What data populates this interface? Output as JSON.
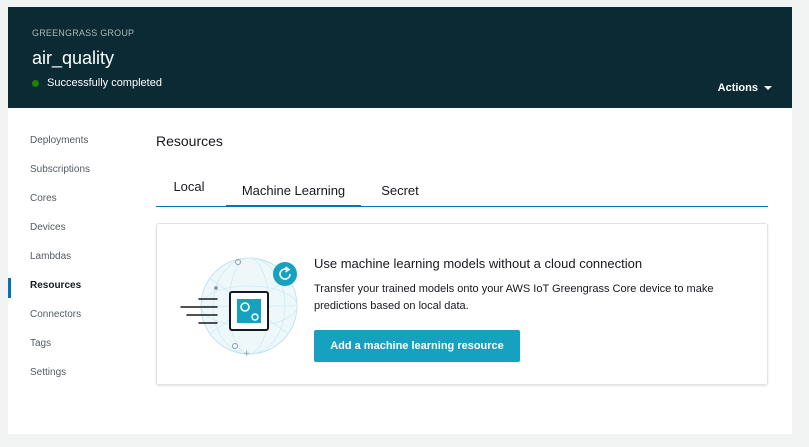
{
  "header": {
    "group_label": "GREENGRASS GROUP",
    "group_name": "air_quality",
    "status_text": "Successfully completed",
    "actions_label": "Actions"
  },
  "sidebar": {
    "items": [
      {
        "label": "Deployments",
        "active": false
      },
      {
        "label": "Subscriptions",
        "active": false
      },
      {
        "label": "Cores",
        "active": false
      },
      {
        "label": "Devices",
        "active": false
      },
      {
        "label": "Lambdas",
        "active": false
      },
      {
        "label": "Resources",
        "active": true
      },
      {
        "label": "Connectors",
        "active": false
      },
      {
        "label": "Tags",
        "active": false
      },
      {
        "label": "Settings",
        "active": false
      }
    ]
  },
  "main": {
    "section_title": "Resources",
    "tabs": [
      {
        "label": "Local",
        "active": false
      },
      {
        "label": "Machine Learning",
        "active": true
      },
      {
        "label": "Secret",
        "active": false
      }
    ],
    "card": {
      "title": "Use machine learning models without a cloud connection",
      "description": "Transfer your trained models onto your AWS IoT Greengrass Core device to make predictions based on local data.",
      "button_label": "Add a machine learning resource",
      "illustration_icon": "ml-device-sync-icon"
    }
  },
  "colors": {
    "header_bg": "#0c2a33",
    "accent": "#0073bb",
    "button_bg": "#16a1c1",
    "status_ok": "#1d8102"
  }
}
